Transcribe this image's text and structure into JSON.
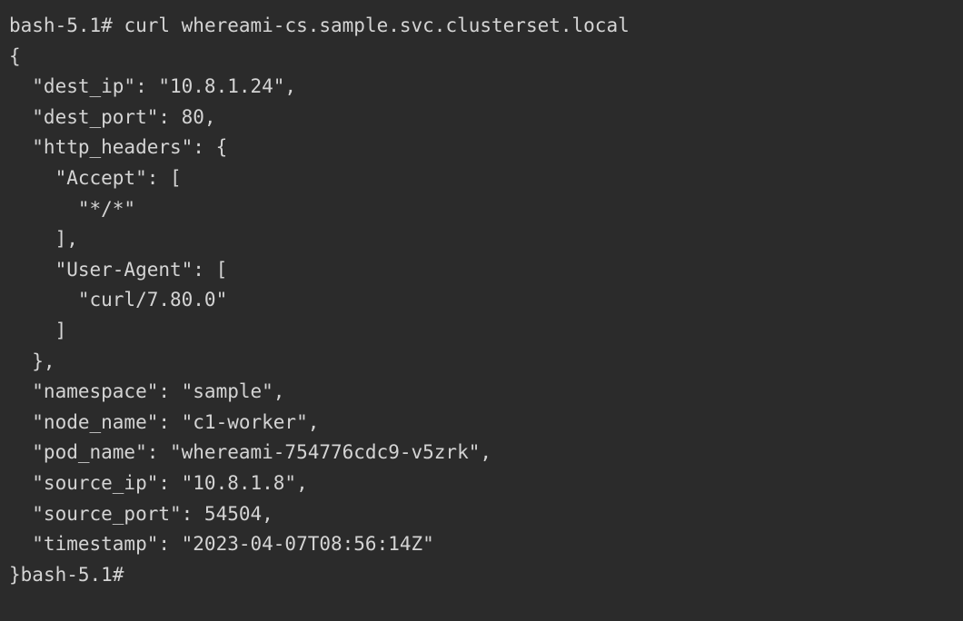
{
  "terminal": {
    "prompt1": "bash-5.1# ",
    "command": "curl whereami-cs.sample.svc.clusterset.local",
    "prompt2": "bash-5.1# ",
    "json_lines": [
      "{",
      "  \"dest_ip\": \"10.8.1.24\",",
      "  \"dest_port\": 80,",
      "  \"http_headers\": {",
      "    \"Accept\": [",
      "      \"*/*\"",
      "    ],",
      "    \"User-Agent\": [",
      "      \"curl/7.80.0\"",
      "    ]",
      "  },",
      "  \"namespace\": \"sample\",",
      "  \"node_name\": \"c1-worker\",",
      "  \"pod_name\": \"whereami-754776cdc9-v5zrk\",",
      "  \"source_ip\": \"10.8.1.8\",",
      "  \"source_port\": 54504,",
      "  \"timestamp\": \"2023-04-07T08:56:14Z\"",
      "}"
    ],
    "response_data": {
      "dest_ip": "10.8.1.24",
      "dest_port": 80,
      "http_headers": {
        "Accept": [
          "*/*"
        ],
        "User-Agent": [
          "curl/7.80.0"
        ]
      },
      "namespace": "sample",
      "node_name": "c1-worker",
      "pod_name": "whereami-754776cdc9-v5zrk",
      "source_ip": "10.8.1.8",
      "source_port": 54504,
      "timestamp": "2023-04-07T08:56:14Z"
    }
  }
}
